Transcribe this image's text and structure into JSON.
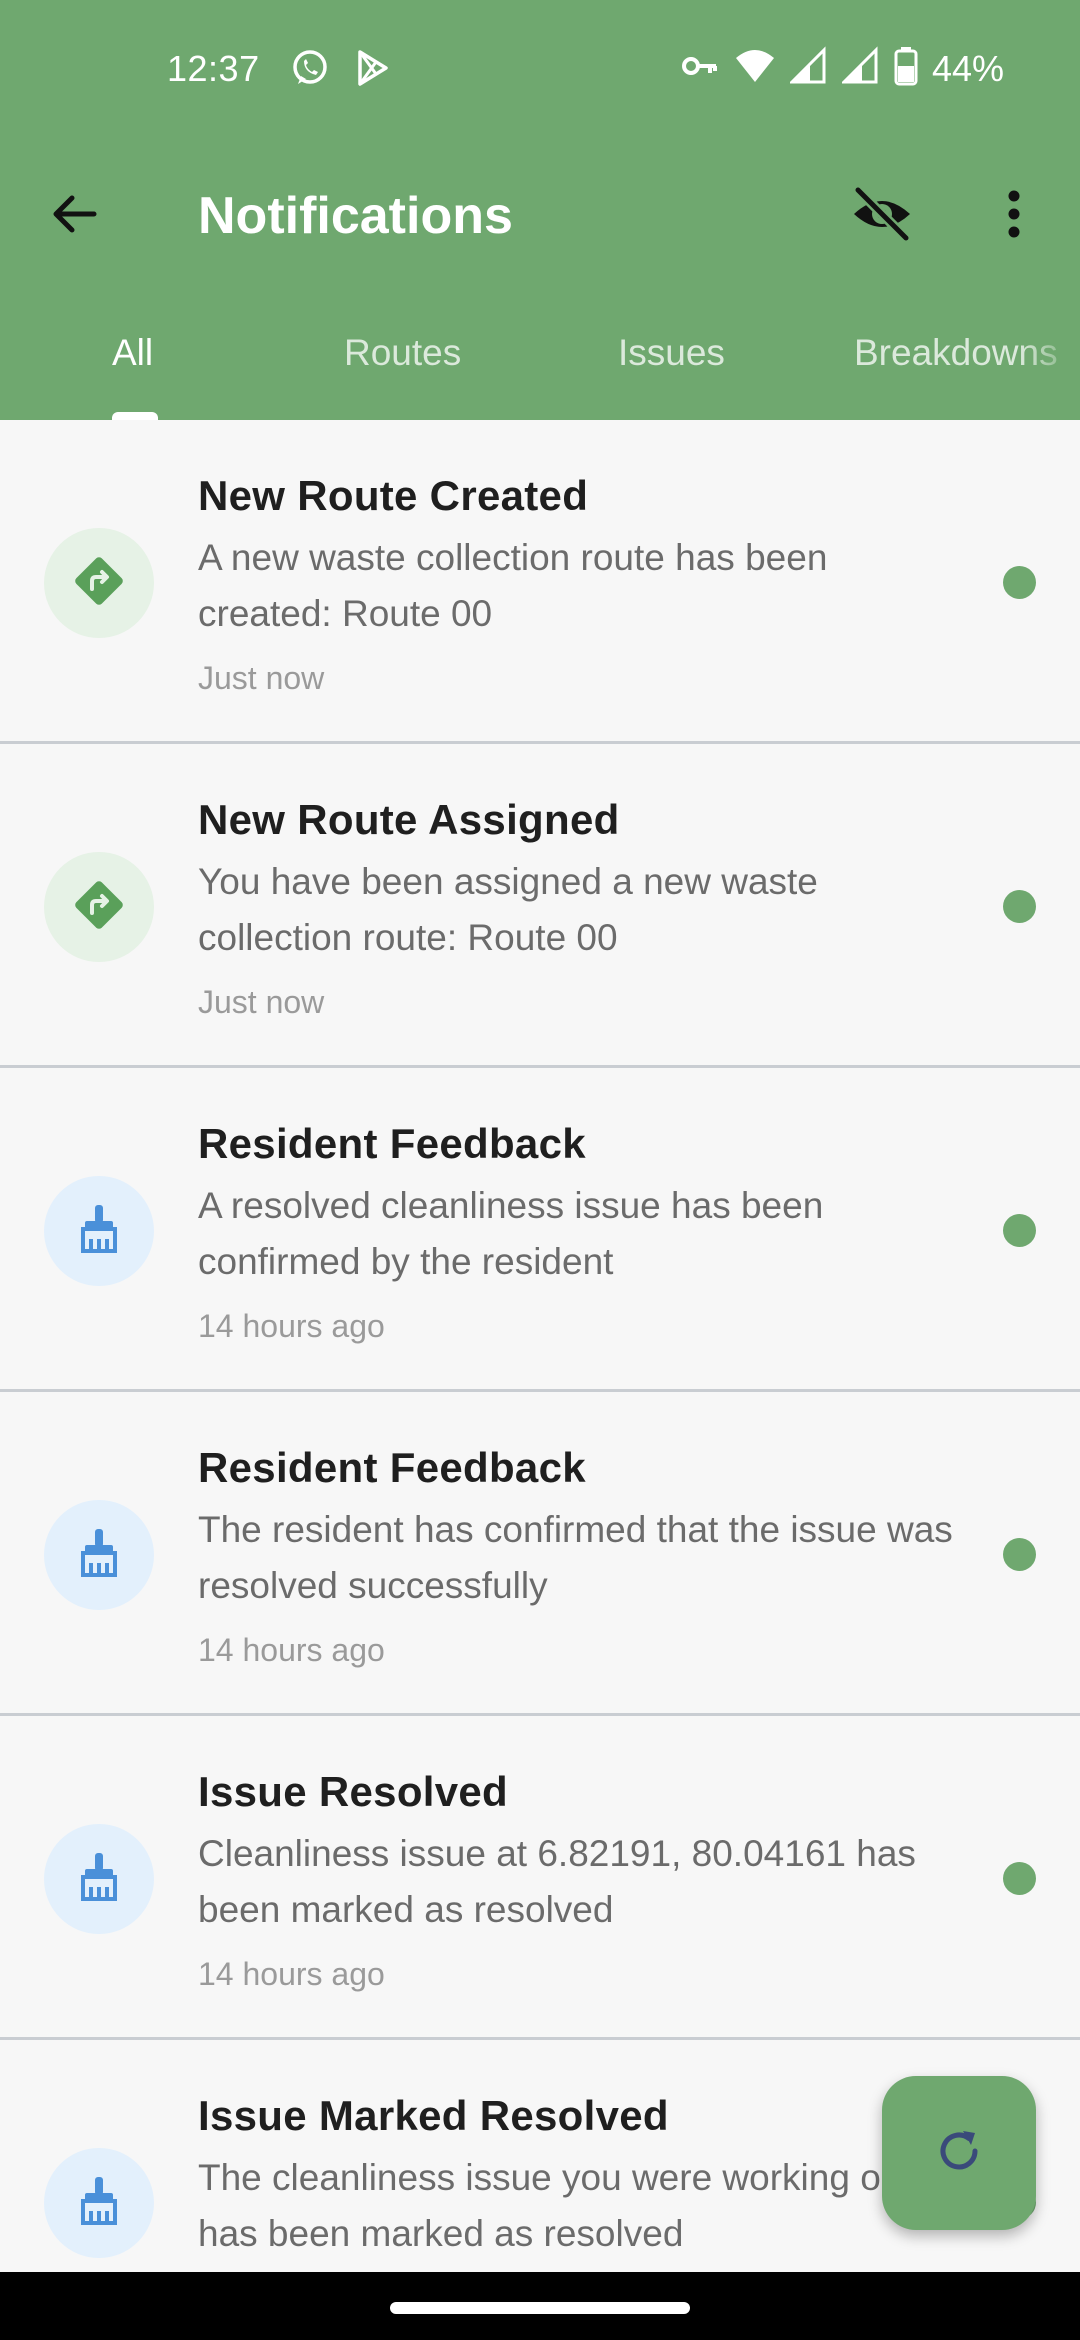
{
  "status_bar": {
    "time": "12:37",
    "battery": "44%",
    "left_icons": [
      "whatsapp-icon",
      "play-store-icon"
    ],
    "right_icons": [
      "key-icon",
      "wifi-icon",
      "signal-icon",
      "signal-icon",
      "battery-icon"
    ]
  },
  "app_bar": {
    "title": "Notifications",
    "back_icon": "arrow-back-icon",
    "visibility_icon": "visibility-off-icon",
    "more_icon": "more-vert-icon"
  },
  "tabs": [
    {
      "label": "All",
      "active": true
    },
    {
      "label": "Routes",
      "active": false
    },
    {
      "label": "Issues",
      "active": false
    },
    {
      "label": "Breakdowns",
      "active": false
    }
  ],
  "notifications": [
    {
      "title": "New Route Created",
      "body": "A new waste collection route has been created: Route 00",
      "time": "Just now",
      "icon": "route-icon",
      "unread": true
    },
    {
      "title": "New Route Assigned",
      "body": "You have been assigned a new waste collection route: Route 00",
      "time": "Just now",
      "icon": "route-icon",
      "unread": true
    },
    {
      "title": "Resident Feedback",
      "body": "A resolved cleanliness issue has been confirmed by the resident",
      "time": "14 hours ago",
      "icon": "broom-icon",
      "unread": true
    },
    {
      "title": "Resident Feedback",
      "body": "The resident has confirmed that the issue was resolved successfully",
      "time": "14 hours ago",
      "icon": "broom-icon",
      "unread": true
    },
    {
      "title": "Issue Resolved",
      "body": "Cleanliness issue at 6.82191, 80.04161 has been marked as resolved",
      "time": "14 hours ago",
      "icon": "broom-icon",
      "unread": true
    },
    {
      "title": "Issue Marked Resolved",
      "body": "The cleanliness issue you were working on has been marked as resolved",
      "time": "",
      "icon": "broom-icon",
      "unread": true
    }
  ],
  "fab": {
    "icon": "refresh-icon"
  },
  "colors": {
    "primary": "#6fa86f",
    "background": "#f7f7f7",
    "route_avatar_bg": "#e6f2e6",
    "route_icon": "#5aa05a",
    "issue_avatar_bg": "#e3f0fc",
    "issue_icon": "#4a90d9",
    "divider": "#c9cdd2",
    "fab_icon": "#3a4a7a"
  }
}
